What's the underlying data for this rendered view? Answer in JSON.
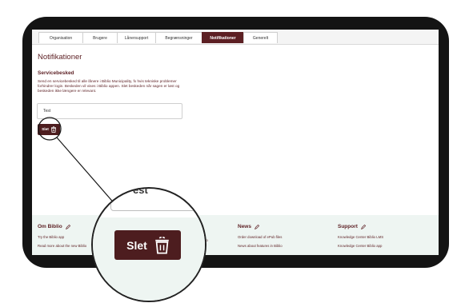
{
  "tabs": [
    {
      "label": "Organisation"
    },
    {
      "label": "Brugere"
    },
    {
      "label": "Lånersupport"
    },
    {
      "label": "Begrænsninger"
    },
    {
      "label": "Notifikationer"
    },
    {
      "label": "Generelt"
    }
  ],
  "active_tab": "Notifikationer",
  "page": {
    "title": "Notifikationer",
    "section_title": "Servicebesked",
    "description": "Send en servicebesked til alle lånere i Biblio Municipality, fx hvis tekniske problemer forhindrer login. Beskeden vil vises i Biblio appen. Slet beskeden når sagen er løst og beskeden ikke længere er relevant.",
    "message_value": "Test",
    "delete_label": "Slet",
    "delete_icon": "trash-icon"
  },
  "footer": {
    "columns": [
      {
        "heading": "Om Biblio",
        "links": [
          "Try the Biblio app",
          "Read more about the new Biblio"
        ]
      },
      {
        "heading": "News",
        "links": [
          "Order download of ePub files",
          "News about features in Biblio"
        ]
      },
      {
        "heading": "Support",
        "links": [
          "Knowledge Center Biblio LMS",
          "Knowledge Center Biblio app"
        ]
      }
    ],
    "edit_icon": "pencil-icon",
    "partial_link_fragment": "bio"
  },
  "zoom": {
    "ghost_text": "est",
    "delete_label": "Slet"
  },
  "colors": {
    "brand": "#5c1f23",
    "button": "#4d1d1f",
    "footer_bg": "#eef5f2",
    "device_frame": "#141414"
  }
}
